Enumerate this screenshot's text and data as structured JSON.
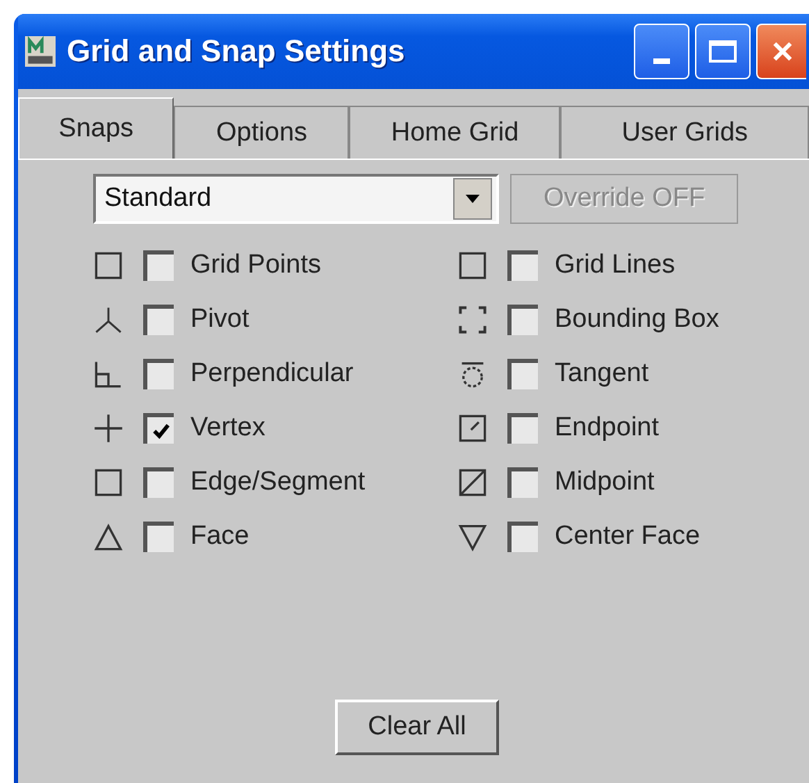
{
  "window": {
    "title": "Grid and Snap Settings"
  },
  "tabs": [
    {
      "label": "Snaps",
      "selected": true
    },
    {
      "label": "Options",
      "selected": false
    },
    {
      "label": "Home Grid",
      "selected": false
    },
    {
      "label": "User Grids",
      "selected": false
    }
  ],
  "dropdown": {
    "value": "Standard"
  },
  "override_button": {
    "label": "Override OFF",
    "disabled": true
  },
  "snaps": [
    {
      "label": "Grid Points",
      "kind": "square",
      "checked": false
    },
    {
      "label": "Grid Lines",
      "kind": "square",
      "checked": false
    },
    {
      "label": "Pivot",
      "kind": "pivot",
      "checked": false
    },
    {
      "label": "Bounding Box",
      "kind": "corners",
      "checked": false
    },
    {
      "label": "Perpendicular",
      "kind": "perp",
      "checked": false
    },
    {
      "label": "Tangent",
      "kind": "tangent",
      "checked": false
    },
    {
      "label": "Vertex",
      "kind": "cross",
      "checked": true
    },
    {
      "label": "Endpoint",
      "kind": "endpoint",
      "checked": false
    },
    {
      "label": "Edge/Segment",
      "kind": "square",
      "checked": false
    },
    {
      "label": "Midpoint",
      "kind": "midpoint",
      "checked": false
    },
    {
      "label": "Face",
      "kind": "triangle",
      "checked": false
    },
    {
      "label": "Center Face",
      "kind": "down-triangle",
      "checked": false
    }
  ],
  "clear_button": {
    "label": "Clear All"
  }
}
